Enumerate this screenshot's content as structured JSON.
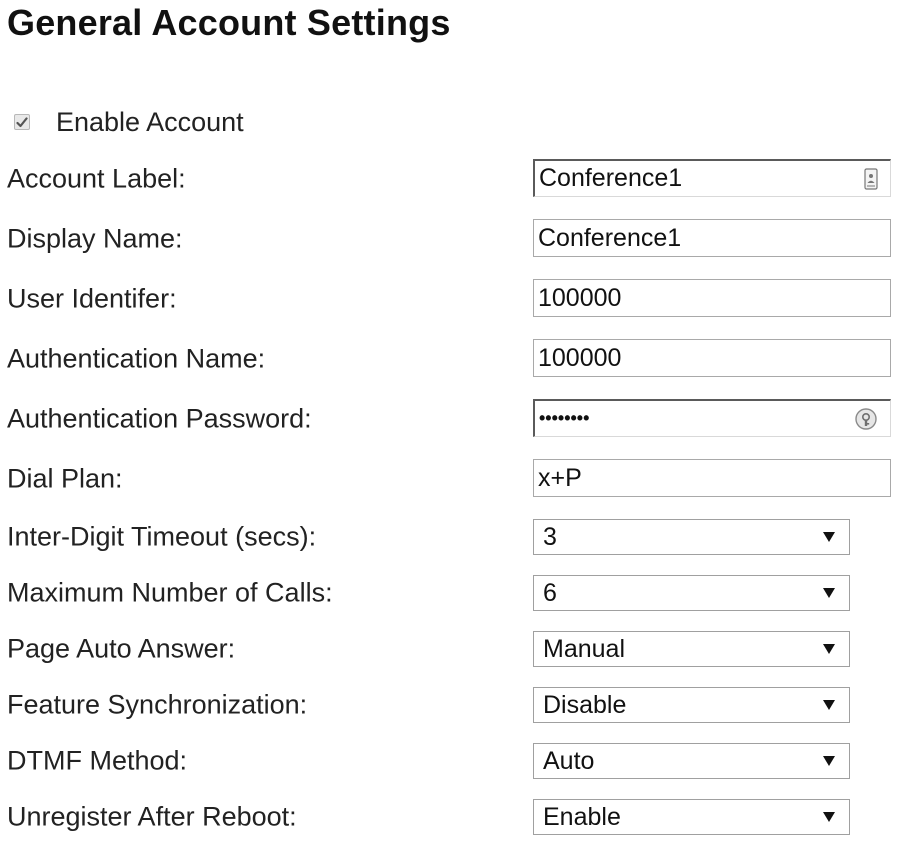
{
  "page": {
    "title": "General Account Settings"
  },
  "enable_account": {
    "label": "Enable Account",
    "checked": true,
    "icon": "checkmark-icon"
  },
  "fields": {
    "account_label": {
      "label": "Account Label:",
      "value": "Conference1",
      "icon": "contact-card-icon"
    },
    "display_name": {
      "label": "Display Name:",
      "value": "Conference1"
    },
    "user_identifier": {
      "label": "User Identifer:",
      "value": "100000"
    },
    "authentication_name": {
      "label": "Authentication Name:",
      "value": "100000"
    },
    "authentication_password": {
      "label": "Authentication Password:",
      "value": "••••••••",
      "icon": "password-reveal-icon"
    },
    "dial_plan": {
      "label": "Dial Plan:",
      "value": "x+P"
    }
  },
  "selects": {
    "inter_digit_timeout": {
      "label": "Inter-Digit Timeout (secs):",
      "value": "3"
    },
    "maximum_number_of_calls": {
      "label": "Maximum Number of Calls:",
      "value": "6"
    },
    "page_auto_answer": {
      "label": "Page Auto Answer:",
      "value": "Manual"
    },
    "feature_synchronization": {
      "label": "Feature Synchronization:",
      "value": "Disable"
    },
    "dtmf_method": {
      "label": "DTMF Method:",
      "value": "Auto"
    },
    "unregister_after_reboot": {
      "label": "Unregister After Reboot:",
      "value": "Enable"
    }
  },
  "colors": {
    "text": "#222222",
    "input_border": "#a9a9a9",
    "background": "#ffffff"
  }
}
